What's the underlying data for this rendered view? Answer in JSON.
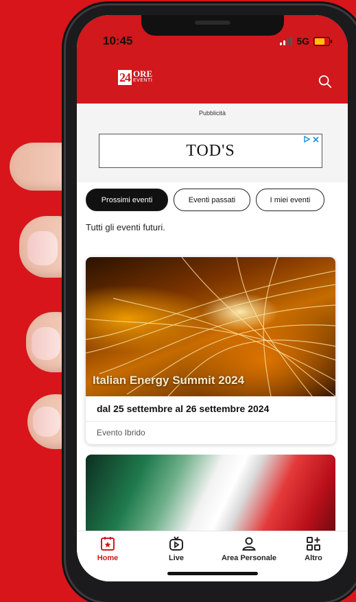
{
  "status_bar": {
    "time": "10:45",
    "network": "5G"
  },
  "header": {
    "logo_number": "24",
    "logo_word": "ORE",
    "logo_sub": "EVENTI"
  },
  "ad": {
    "label": "Pubblicità",
    "brand": "TOD'S"
  },
  "tabs": [
    {
      "label": "Prossimi eventi",
      "active": true
    },
    {
      "label": "Eventi passati",
      "active": false
    },
    {
      "label": "I miei eventi",
      "active": false
    }
  ],
  "subtitle": "Tutti gli eventi futuri.",
  "events": [
    {
      "title": "Italian Energy Summit 2024",
      "date": "dal 25 settembre al 26 settembre 2024",
      "type": "Evento Ibrido"
    }
  ],
  "bottom_nav": [
    {
      "label": "Home",
      "icon": "calendar-star-icon",
      "active": true
    },
    {
      "label": "Live",
      "icon": "tv-play-icon",
      "active": false
    },
    {
      "label": "Area Personale",
      "icon": "user-icon",
      "active": false
    },
    {
      "label": "Altro",
      "icon": "grid-plus-icon",
      "active": false
    }
  ],
  "colors": {
    "brand_red": "#d0181d",
    "background_red": "#d8151b",
    "active_tab": "#111111"
  }
}
